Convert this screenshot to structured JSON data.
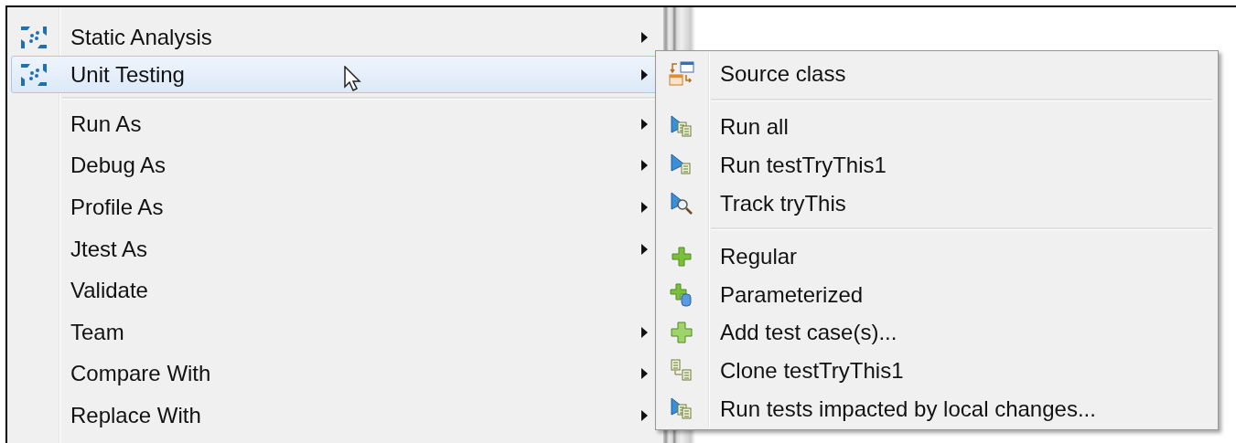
{
  "menu": {
    "items": [
      {
        "kind": "item",
        "label": "Static Analysis",
        "submenu": true,
        "selected": false
      },
      {
        "kind": "item",
        "label": "Unit Testing",
        "submenu": true,
        "selected": true
      },
      {
        "kind": "separator"
      },
      {
        "kind": "item",
        "label": "Run As",
        "submenu": true,
        "selected": false
      },
      {
        "kind": "item",
        "label": "Debug As",
        "submenu": true,
        "selected": false
      },
      {
        "kind": "item",
        "label": "Profile As",
        "submenu": true,
        "selected": false
      },
      {
        "kind": "item",
        "label": "Jtest As",
        "submenu": true,
        "selected": false
      },
      {
        "kind": "item",
        "label": "Validate",
        "submenu": false,
        "selected": false
      },
      {
        "kind": "item",
        "label": "Team",
        "submenu": true,
        "selected": false
      },
      {
        "kind": "item",
        "label": "Compare With",
        "submenu": true,
        "selected": false
      },
      {
        "kind": "item",
        "label": "Replace With",
        "submenu": true,
        "selected": false
      }
    ]
  },
  "submenu": {
    "items": [
      {
        "kind": "item",
        "label": "Source class"
      },
      {
        "kind": "separator"
      },
      {
        "kind": "item",
        "label": "Run all"
      },
      {
        "kind": "item",
        "label": "Run testTryThis1"
      },
      {
        "kind": "item",
        "label": "Track tryThis"
      },
      {
        "kind": "separator"
      },
      {
        "kind": "item",
        "label": "Regular"
      },
      {
        "kind": "item",
        "label": "Parameterized"
      },
      {
        "kind": "item",
        "label": "Add test case(s)..."
      },
      {
        "kind": "item",
        "label": "Clone testTryThis1"
      },
      {
        "kind": "item",
        "label": "Run tests impacted by local changes..."
      }
    ]
  }
}
